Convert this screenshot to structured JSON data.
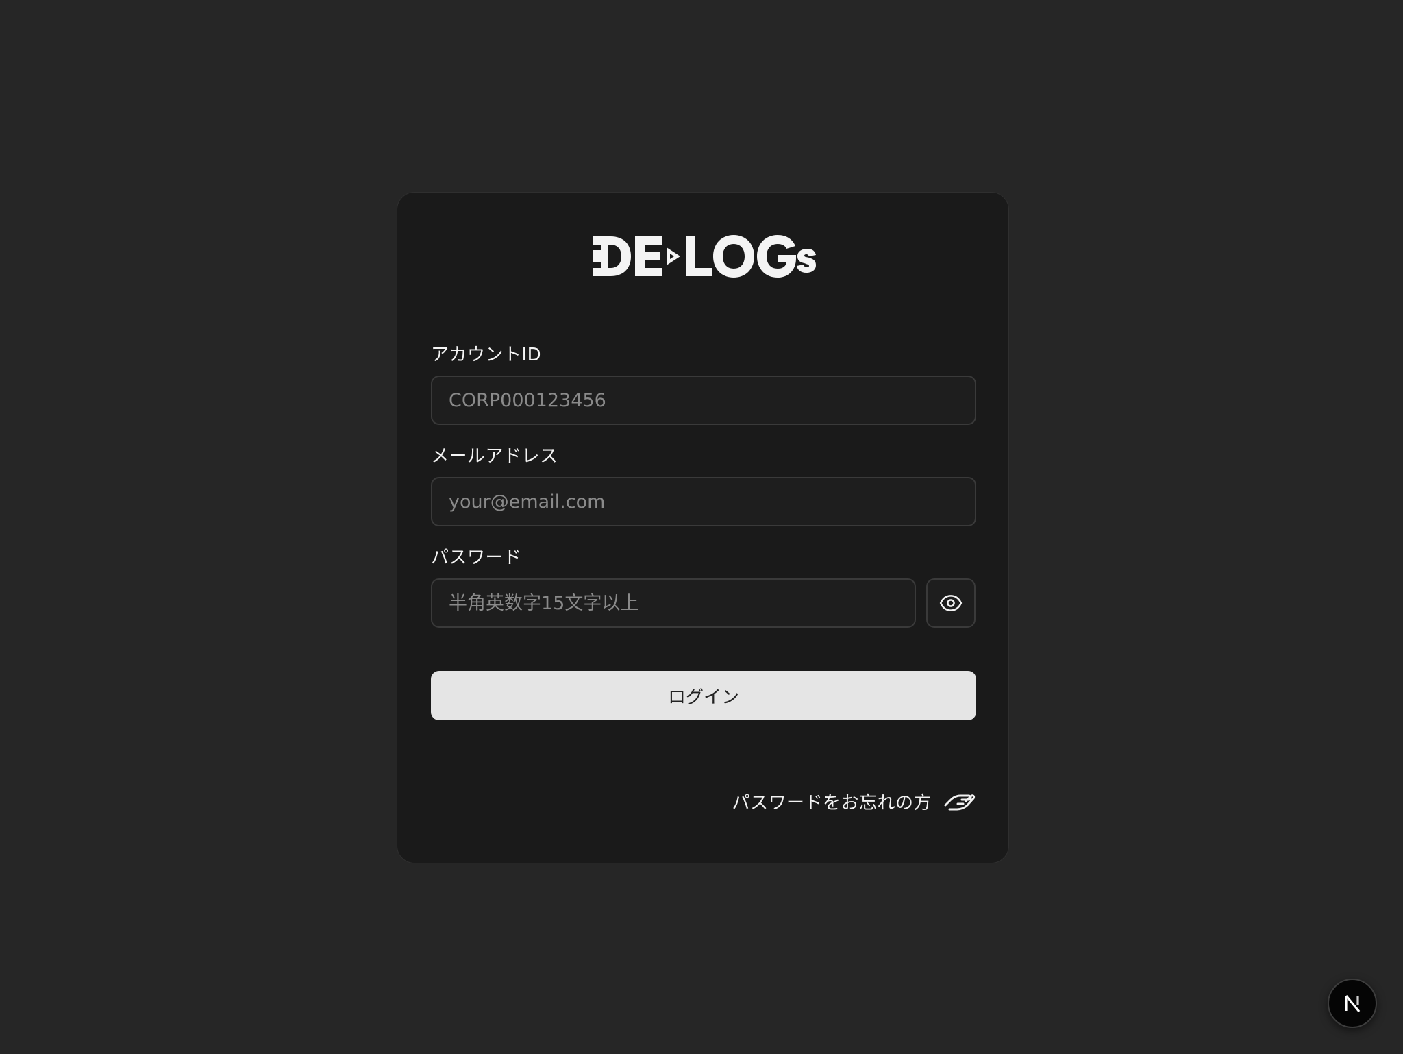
{
  "brand": {
    "logo_text": "DE▷LOGs"
  },
  "form": {
    "account_id": {
      "label": "アカウントID",
      "placeholder": "CORP000123456",
      "value": ""
    },
    "email": {
      "label": "メールアドレス",
      "placeholder": "your@email.com",
      "value": ""
    },
    "password": {
      "label": "パスワード",
      "placeholder": "半角英数字15文字以上",
      "value": "",
      "toggle_icon": "eye-icon"
    },
    "login_label": "ログイン",
    "forgot_label": "パスワードをお忘れの方",
    "forgot_icon": "helping-hand-icon"
  },
  "dev_badge": {
    "icon": "nextjs-n-icon"
  },
  "colors": {
    "page_bg": "#262626",
    "card_bg": "#1a1a1a",
    "input_bg": "#1e1e1e",
    "input_border": "#3a3a3a",
    "button_bg": "#e5e5e5",
    "text": "#f2f2f2",
    "placeholder": "#8a8a8a"
  }
}
